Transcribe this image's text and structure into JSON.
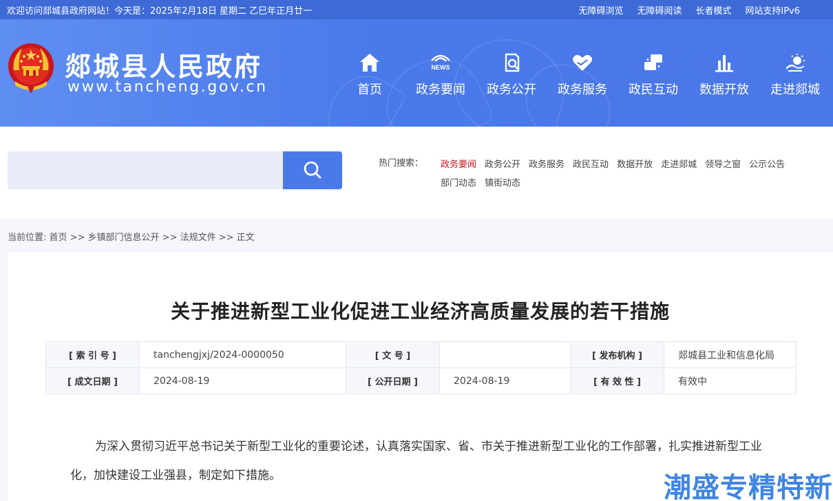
{
  "topbar": {
    "welcome": "欢迎访问郯城县政府网站！今天是：2025年2月18日  星期二  乙巳年正月廿一",
    "links": [
      "无障碍浏览",
      "无障碍阅读",
      "长者模式",
      "网站支持IPv6"
    ]
  },
  "header": {
    "site_title": "郯城县人民政府",
    "site_url": "www.tancheng.gov.cn",
    "news_badge": "NEWS"
  },
  "nav": [
    {
      "label": "首页",
      "icon": "home-icon"
    },
    {
      "label": "政务要闻",
      "icon": "news-icon"
    },
    {
      "label": "政务公开",
      "icon": "document-search-icon"
    },
    {
      "label": "政务服务",
      "icon": "heart-hands-icon"
    },
    {
      "label": "政民互动",
      "icon": "chat-exchange-icon"
    },
    {
      "label": "数据开放",
      "icon": "bar-chart-icon"
    },
    {
      "label": "走进郯城",
      "icon": "landscape-sun-icon"
    }
  ],
  "search": {
    "placeholder": "",
    "button_icon": "search-icon",
    "hot_label": "热门搜索：",
    "hot_terms": [
      "政务要闻",
      "政务公开",
      "政务服务",
      "政民互动",
      "数据开放",
      "走进郯城",
      "领导之窗",
      "公示公告",
      "部门动态",
      "镇街动态"
    ]
  },
  "breadcrumb": "当前位置: 首页 >> 乡镇部门信息公开 >> 法规文件 >> 正文",
  "article": {
    "title": "关于推进新型工业化促进工业经济高质量发展的若干措施",
    "meta": {
      "index_label": "[ 索 引 号 ]",
      "index_value": "tanchengjxj/2024-0000050",
      "docno_label": "[ 文      号 ]",
      "docno_value": "",
      "org_label": "[ 发布机构 ]",
      "org_value": "郯城县工业和信息化局",
      "created_label": "[ 成文日期 ]",
      "created_value": "2024-08-19",
      "published_label": "[ 公开日期 ]",
      "published_value": "2024-08-19",
      "validity_label": "[ 有 效 性 ]",
      "validity_value": "有效中"
    },
    "body": "为深入贯彻习近平总书记关于新型工业化的重要论述，认真落实国家、省、市关于推进新型工业化的工作部署，扎实推进新型工业化，加快建设工业强县，制定如下措施。"
  },
  "watermark": "潮盛专精特新",
  "colors": {
    "primary": "#4a79ea",
    "topbar": "#3e6ad6",
    "active_hot": "#c8161e"
  }
}
